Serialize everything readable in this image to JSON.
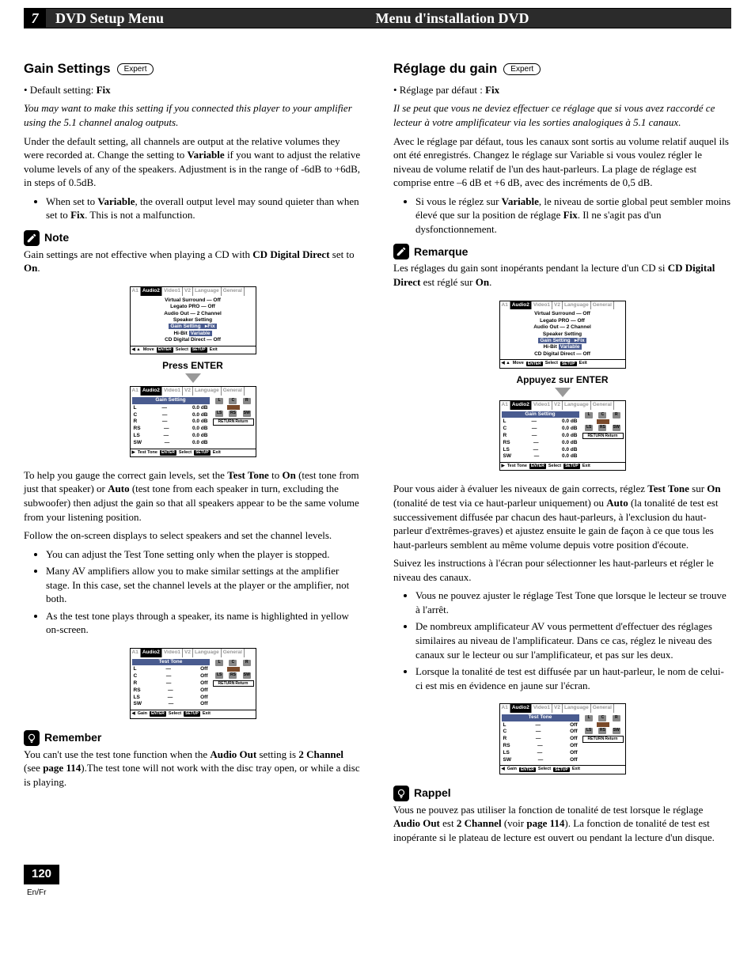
{
  "header": {
    "chapter": "7",
    "title_en": "DVD Setup Menu",
    "title_fr": "Menu d'installation DVD"
  },
  "en": {
    "h2": "Gain Settings",
    "badge": "Expert",
    "default_label": "• Default setting: ",
    "default_value": "Fix",
    "intro_italic": "You may want to make this setting if you connected this player to your amplifier using the 5.1 channel analog outputs.",
    "para1a": "Under the default setting, all channels are output at the relative volumes they were recorded at. Change the setting to ",
    "para1_b1": "Variable",
    "para1b": " if you want to adjust the relative volume levels of any of the speakers. Adjustment is in the range of -6dB to +6dB, in steps of 0.5dB.",
    "bullet1a": "When set to ",
    "bullet1_b1": "Variable",
    "bullet1b": ", the overall output level may sound quieter than when set to ",
    "bullet1_b2": "Fix",
    "bullet1c": ". This is not a malfunction.",
    "note_head": "Note",
    "note_a": "Gain settings are not effective when playing a CD with ",
    "note_b1": "CD Digital Direct",
    "note_b": " set to ",
    "note_b2": "On",
    "note_c": ".",
    "press_enter": "Press ENTER",
    "para2a": "To help you gauge the correct gain levels, set the ",
    "para2_b1": "Test Tone",
    "para2b": " to ",
    "para2_b2": "On",
    "para2c": " (test tone from just that speaker) or ",
    "para2_b3": "Auto",
    "para2d": " (test tone from each speaker in turn, excluding the subwoofer) then adjust the gain so that all speakers appear to be the same volume from your listening position.",
    "para3": "Follow the on-screen displays to select speakers and set the channel levels.",
    "bullets2": [
      "You can adjust the Test Tone setting only when the player is stopped.",
      "Many AV amplifiers allow you to make similar settings at the amplifier stage. In this case, set the channel levels at the player or the amplifier, not both.",
      "As the test tone plays through a speaker, its name is highlighted in yellow on-screen."
    ],
    "remember_head": "Remember",
    "remember_a": "You can't use the test tone function when the ",
    "remember_b1": "Audio Out",
    "remember_b": " setting is ",
    "remember_b2": "2 Channel",
    "remember_c": " (see ",
    "remember_b3": "page 114",
    "remember_d": ").The test tone will not work with the disc tray open, or while a disc is playing."
  },
  "fr": {
    "h2": "Réglage du gain",
    "badge": "Expert",
    "default_label": "• Réglage par défaut : ",
    "default_value": "Fix",
    "intro_italic": "Il se peut que vous ne deviez effectuer ce réglage que si vous avez raccordé ce lecteur à votre amplificateur via les sorties analogiques à 5.1 canaux.",
    "para1": "Avec le réglage par défaut, tous les canaux sont sortis au volume relatif auquel ils ont été enregistrés. Changez le réglage sur Variable si vous voulez régler le niveau de volume relatif de l'un des haut-parleurs. La plage de réglage est comprise entre –6 dB et +6 dB, avec des incréments de 0,5 dB.",
    "bullet1a": "Si vous le réglez sur ",
    "bullet1_b1": "Variable",
    "bullet1b": ", le niveau de sortie global peut sembler moins élevé que sur la position de réglage ",
    "bullet1_b2": "Fix",
    "bullet1c": ". Il ne s'agit pas d'un dysfonctionnement.",
    "note_head": "Remarque",
    "note_a": "Les réglages du gain sont inopérants pendant la lecture d'un CD si ",
    "note_b1": "CD Digital Direct",
    "note_b": " est réglé sur ",
    "note_b2": "On",
    "note_c": ".",
    "press_enter": "Appuyez sur ENTER",
    "para2a": "Pour vous aider à évaluer les niveaux de gain corrects, réglez ",
    "para2_b1": "Test Tone",
    "para2b": " sur ",
    "para2_b2": "On",
    "para2c": " (tonalité de test via ce haut-parleur uniquement) ou ",
    "para2_b3": "Auto",
    "para2d": " (la tonalité de test est successivement diffusée par chacun des haut-parleurs, à l'exclusion du haut-parleur d'extrêmes-graves) et ajustez ensuite le gain de façon à ce que tous les haut-parleurs semblent au même volume depuis votre position d'écoute.",
    "para3": "Suivez les instructions à l'écran pour sélectionner les haut-parleurs et régler le niveau des canaux.",
    "bullets2": [
      "Vous ne pouvez ajuster le réglage Test Tone que lorsque le lecteur se trouve à l'arrêt.",
      "De nombreux amplificateur AV vous permettent d'effectuer des réglages similaires au niveau de l'amplificateur. Dans ce cas, réglez le niveau des canaux sur le lecteur ou sur l'amplificateur, et pas sur les deux.",
      "Lorsque la tonalité de test est diffusée par un haut-parleur, le nom de celui-ci est mis en évidence en jaune sur l'écran."
    ],
    "remember_head": "Rappel",
    "remember_a": "Vous ne pouvez pas utiliser la fonction de tonalité de test lorsque le réglage ",
    "remember_b1": "Audio Out",
    "remember_b": " est ",
    "remember_b2": "2 Channel",
    "remember_c": " (voir ",
    "remember_b3": "page 114",
    "remember_d": "). La fonction de tonalité de test est inopérante si le plateau de lecture est ouvert ou pendant la lecture d'un disque."
  },
  "osd": {
    "tabs": [
      "A1",
      "Audio2",
      "Video1",
      "V2",
      "Language",
      "General"
    ],
    "menu1_rows": [
      "Virtual Surround — Off",
      "Legato PRO — Off",
      "Audio Out — 2 Channel",
      "Speaker Setting",
      "Gain Setting   ▸Fix",
      "Hi-Bit   Variable",
      "CD Digital Direct — Off"
    ],
    "foot1": {
      "move": "Move",
      "enter": "ENTER",
      "select": "Select",
      "setup": "SETUP",
      "exit": "Exit"
    },
    "gain_title": "Gain Setting",
    "gain_rows": [
      {
        "ch": "L",
        "val": "0.0 dB"
      },
      {
        "ch": "C",
        "val": "0.0 dB"
      },
      {
        "ch": "R",
        "val": "0.0 dB"
      },
      {
        "ch": "RS",
        "val": "0.0 dB"
      },
      {
        "ch": "LS",
        "val": "0.0 dB"
      },
      {
        "ch": "SW",
        "val": "0.0 dB"
      }
    ],
    "foot2_left": "Test Tone",
    "return": "Return",
    "return_btn": "RETURN",
    "tt_title": "Test Tone",
    "tt_rows": [
      {
        "ch": "L",
        "val": "Off"
      },
      {
        "ch": "C",
        "val": "Off"
      },
      {
        "ch": "R",
        "val": "Off"
      },
      {
        "ch": "RS",
        "val": "Off"
      },
      {
        "ch": "LS",
        "val": "Off"
      },
      {
        "ch": "SW",
        "val": "Off"
      }
    ],
    "foot3_left": "Gain",
    "spk_labels": {
      "L": "L",
      "C": "C",
      "R": "R",
      "LS": "LS",
      "RS": "RS",
      "SW": "SW"
    }
  },
  "page": {
    "num": "120",
    "langs": "En/Fr"
  }
}
